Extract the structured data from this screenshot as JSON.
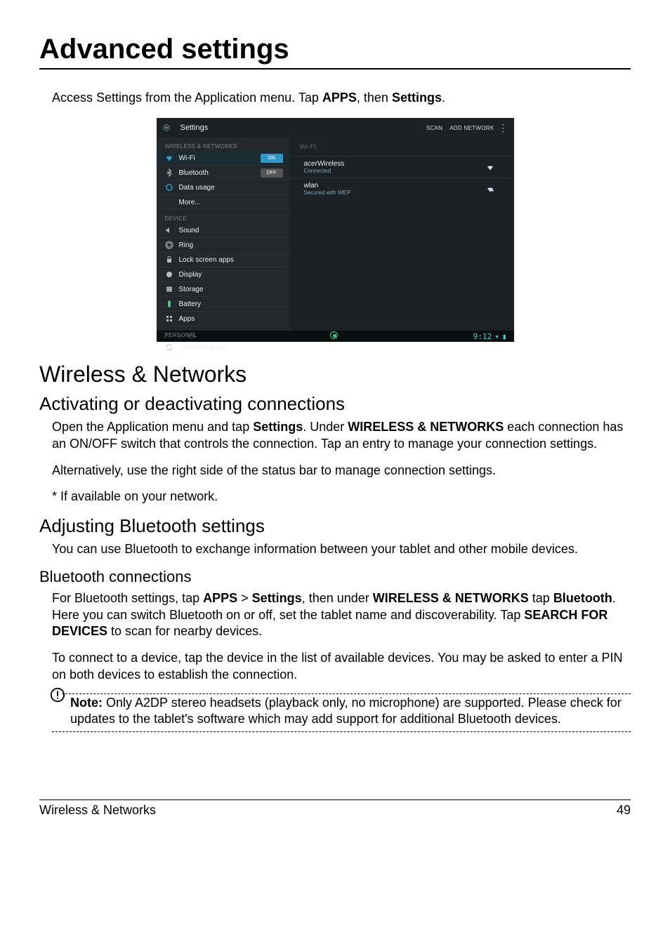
{
  "page": {
    "title": "Advanced settings",
    "intro_prefix": "Access Settings from the Application menu. Tap ",
    "intro_apps": "APPS",
    "intro_mid": ", then ",
    "intro_settings": "Settings",
    "intro_suffix": "."
  },
  "screenshot": {
    "topbar_title": "Settings",
    "action_scan": "SCAN",
    "action_add": "ADD NETWORK",
    "side": {
      "section_wireless": "WIRELESS & NETWORKS",
      "wifi": "Wi-Fi",
      "wifi_tog": "ON",
      "bt": "Bluetooth",
      "bt_tog": "OFF",
      "data": "Data usage",
      "more": "More...",
      "section_device": "DEVICE",
      "sound": "Sound",
      "ring": "Ring",
      "lock": "Lock screen apps",
      "display": "Display",
      "storage": "Storage",
      "battery": "Battery",
      "apps": "Apps",
      "section_personal": "PERSONAL",
      "accounts": "Accounts & sync"
    },
    "main": {
      "header": "Wi-Fi",
      "row1_t": "acerWireless",
      "row1_s": "Connected",
      "row2_t": "wlan",
      "row2_s": "Secured with WEP"
    },
    "navbar_time": "9:12"
  },
  "sections": {
    "wireless_heading": "Wireless & Networks",
    "activating_heading": "Activating or deactivating connections",
    "activating_p1_a": "Open the Application menu and tap ",
    "activating_p1_b": "Settings",
    "activating_p1_c": ". Under ",
    "activating_p1_d": "WIRELESS & NETWORKS",
    "activating_p1_e": " each connection has an ON/OFF switch that controls the connection. Tap an entry to manage your connection settings.",
    "activating_p2": "Alternatively, use the right side of the status bar to manage connection settings.",
    "activating_p3": "* If available on your network.",
    "bluetooth_heading": "Adjusting Bluetooth settings",
    "bluetooth_p1": "You can use Bluetooth to exchange information between your tablet and other mobile devices.",
    "btconn_heading": "Bluetooth connections",
    "btconn_p1_a": "For Bluetooth settings, tap ",
    "btconn_p1_b": "APPS",
    "btconn_p1_c": " > ",
    "btconn_p1_d": "Settings",
    "btconn_p1_e": ", then under ",
    "btconn_p1_f": "WIRELESS & NETWORKS",
    "btconn_p1_g": " tap ",
    "btconn_p1_h": "Bluetooth",
    "btconn_p1_i": ". Here you can switch Bluetooth on or off, set the tablet name and discoverability. Tap ",
    "btconn_p1_j": "SEARCH FOR DEVICES",
    "btconn_p1_k": " to scan for nearby devices.",
    "btconn_p2": "To connect to a device, tap the device in the list of available devices. You may be asked to enter a PIN on both devices to establish the connection.",
    "note_label": "Note:",
    "note_body": " Only A2DP stereo headsets (playback only, no microphone) are supported. Please check for updates to the tablet's software which may add support for additional Bluetooth devices."
  },
  "footer": {
    "left": "Wireless & Networks",
    "right": "49"
  }
}
